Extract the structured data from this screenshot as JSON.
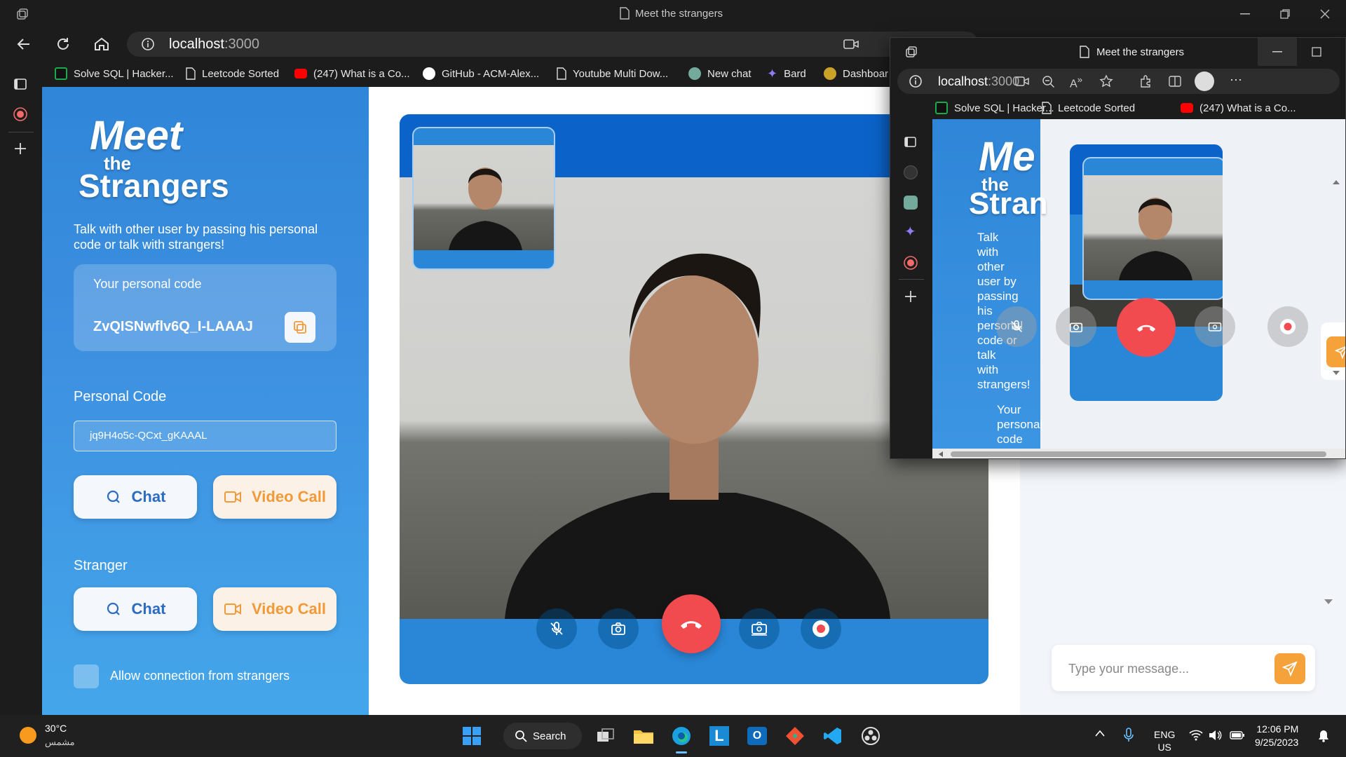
{
  "window": {
    "title": "Meet the strangers"
  },
  "browser": {
    "url_host": "localhost",
    "url_port": ":3000",
    "bookmarks": [
      {
        "label": "Solve SQL | Hacker...",
        "icon": "hackerrank-icon",
        "color": "#1ba94c"
      },
      {
        "label": "Leetcode Sorted",
        "icon": "page-icon",
        "color": "#dddddd"
      },
      {
        "label": "(247) What is a Co...",
        "icon": "youtube-icon",
        "color": "#ff0000"
      },
      {
        "label": "GitHub - ACM-Alex...",
        "icon": "github-icon",
        "color": "#ffffff"
      },
      {
        "label": "Youtube Multi Dow...",
        "icon": "page-icon",
        "color": "#dddddd"
      },
      {
        "label": "New chat",
        "icon": "chatgpt-icon",
        "color": "#74aa9c"
      },
      {
        "label": "Bard",
        "icon": "bard-icon",
        "color": "#8e7cf0"
      },
      {
        "label": "Dashboar",
        "icon": "dashboard-icon",
        "color": "#c9a227"
      }
    ]
  },
  "app": {
    "logo_line1": "Meet",
    "logo_line2": "the",
    "logo_line3": "Strangers",
    "description": "Talk with other user by passing his personal code or talk with strangers!",
    "personal_code_label": "Your personal code",
    "personal_code_value": "ZvQISNwflv6Q_I-LAAAJ",
    "personal_code_section": "Personal Code",
    "personal_code_input": "jq9H4o5c-QCxt_gKAAAL",
    "chat_label": "Chat",
    "video_call_label": "Video Call",
    "stranger_section": "Stranger",
    "allow_label": "Allow connection from strangers",
    "message_placeholder": "Type your message..."
  },
  "popup": {
    "title": "Meet the strangers",
    "url_host": "localhost",
    "url_port": ":3000",
    "bookmarks": [
      "Solve SQL | Hacker...",
      "Leetcode Sorted",
      "(247) What is a Co..."
    ],
    "logo_line1": "Me",
    "logo_line2": "the",
    "logo_line3": "Stran",
    "desc_words": [
      "Talk",
      "with",
      "other",
      "user by",
      "passing",
      "his",
      "personal",
      "code or",
      "talk",
      "with",
      "strangers!"
    ],
    "code_words": [
      "Your",
      "personal",
      "code"
    ]
  },
  "taskbar": {
    "temperature": "30°C",
    "weather": "مشمس",
    "search_label": "Search",
    "lang1": "ENG",
    "lang2": "US",
    "time": "12:06 PM",
    "date": "9/25/2023"
  },
  "colors": {
    "end_call": "#f24b4f",
    "accent_orange": "#f5a23b",
    "sidebar_blue": "#2f86d8"
  }
}
